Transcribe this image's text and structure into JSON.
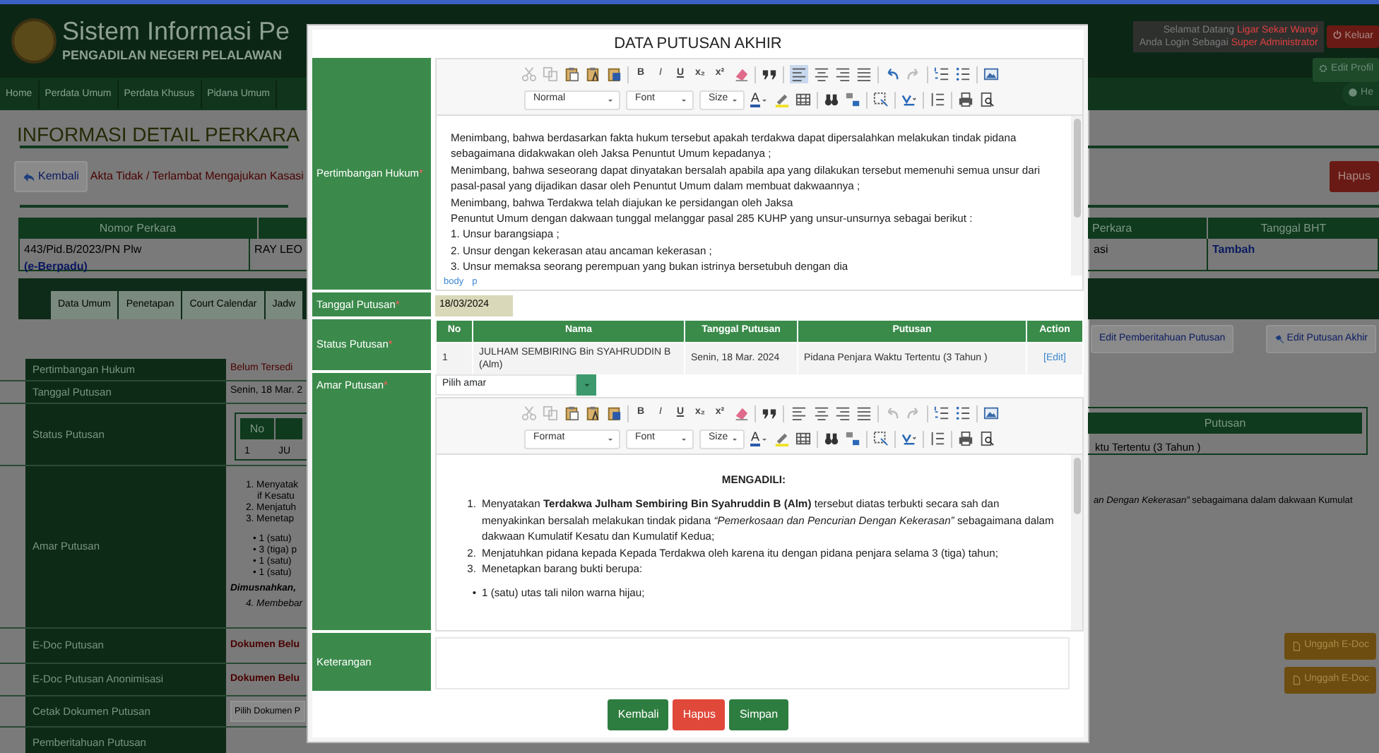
{
  "header": {
    "title": "Sistem Informasi Pe",
    "subtitle": "PENGADILAN NEGERI PELALAWAN",
    "welcome": {
      "greeting": "Selamat Datang",
      "user": "Ligar Sekar Wangi",
      "login_as": "Anda Login Sebagai",
      "role": "Super Administrator"
    },
    "logout_button": "Keluar",
    "profile_button": "Edit Profil"
  },
  "nav": {
    "items": [
      "Home",
      "Perdata Umum",
      "Perdata Khusus",
      "Pidana Umum"
    ],
    "help_button": "He"
  },
  "page": {
    "title": "INFORMASI DETAIL PERKARA",
    "back_button": "Kembali",
    "notice": "Akta Tidak / Terlambat Mengajukan Kasasi",
    "delete_button": "Hapus",
    "case_table": {
      "columns": [
        "Nomor Perkara",
        "Perkara",
        "Tanggal BHT"
      ],
      "cells": [
        "443/Pid.B/2023/PN Plw",
        "RAY LEO",
        "asi",
        "Tambah"
      ],
      "tag": "(e-Berpadu)"
    },
    "tabs": [
      "Data Umum",
      "Penetapan",
      "Court Calendar",
      "Jadw"
    ],
    "action_buttons": [
      "Edit Pemberitahuan Putusan",
      "Edit Putusan Akhir"
    ],
    "details": {
      "labels": [
        "Pertimbangan Hukum",
        "Tanggal Putusan",
        "Status Putusan",
        "Amar Putusan",
        "E-Doc Putusan",
        "E-Doc Putusan Anonimisasi",
        "Cetak Dokumen Putusan",
        "Pemberitahuan Putusan"
      ],
      "pertimbangan": "Belum Tersedi",
      "tanggal": "Senin, 18 Mar. 2",
      "status_table": {
        "columns": [
          "No",
          "Putusan"
        ],
        "cells": [
          "1",
          "JU",
          "ktu Tertentu (3 Tahun )"
        ]
      },
      "amar_lines": [
        {
          "kind": "numbered",
          "text": "1. Menyatak"
        },
        {
          "kind": "continued",
          "text": "if Kesatu"
        },
        {
          "kind": "numbered",
          "text": "2. Menjatuh"
        },
        {
          "kind": "numbered",
          "text": "3. Menetap"
        },
        {
          "kind": "bullet",
          "text": "• 1 (satu)"
        },
        {
          "kind": "bullet",
          "text": "• 3 (tiga) p"
        },
        {
          "kind": "bullet",
          "text": "• 1 (satu)"
        },
        {
          "kind": "bullet",
          "text": "• 1 (satu)"
        },
        {
          "kind": "note",
          "text": "Dimusnahkan,"
        },
        {
          "kind": "numbered",
          "text": "4. Membebar"
        }
      ],
      "amar_tail": "*an Dengan Kekerasan”* sebagaimana dalam dakwaan Kumulat",
      "edoc": [
        "Dokumen Belu",
        "Dokumen Belu"
      ],
      "upload_buttons": [
        "Unggah E-Doc",
        "Unggah E-Doc"
      ],
      "print_select": "Pilih Dokumen P"
    }
  },
  "modal": {
    "title": "DATA PUTUSAN AKHIR",
    "fields": [
      {
        "kind": "editor",
        "label": "Pertimbangan Hukum",
        "marker": "*",
        "toolbar": {
          "style": "Normal",
          "font": "Font",
          "size": "Size",
          "glyphs": [
            "B",
            "I",
            "U",
            "x₂",
            "x²"
          ],
          "color_glyph": "A",
          "align_left_active": true,
          "undo_enabled": true
        },
        "blocks": [
          {
            "kind": "p",
            "text": "Menimbang, bahwa berdasarkan fakta hukum tersebut apakah terdakwa dapat dipersalahkan melakukan tindak pidana sebagaimana didakwakan oleh Jaksa Penuntut Umum kepadanya ;"
          },
          {
            "kind": "p",
            "text": "Menimbang, bahwa seseorang dapat dinyatakan bersalah apabila apa yang dilakukan tersebut memenuhi semua unsur dari pasal-pasal yang dijadikan dasar oleh Penuntut Umum dalam membuat dakwaannya ;"
          },
          {
            "kind": "p",
            "text": "Menimbang, bahwa Terdakwa telah diajukan ke persidangan oleh Jaksa"
          },
          {
            "kind": "p",
            "text": "Penuntut Umum dengan dakwaan tunggal melanggar pasal 285 KUHP yang unsur-unsurnya sebagai berikut :"
          },
          {
            "kind": "p",
            "text": "1. Unsur barangsiapa ;"
          },
          {
            "kind": "p",
            "text": "2. Unsur dengan kekerasan atau ancaman kekerasan ;"
          },
          {
            "kind": "p",
            "text": "3. Unsur memaksa seorang perempuan yang bukan istrinya bersetubuh dengan dia"
          }
        ],
        "path": [
          "body",
          "p"
        ]
      },
      {
        "kind": "date",
        "label": "Tanggal Putusan",
        "marker": "*",
        "value": "18/03/2024"
      },
      {
        "kind": "table",
        "label": "Status Putusan",
        "marker": "*",
        "columns": [
          "No",
          "Nama",
          "Tanggal Putusan",
          "Putusan",
          "Action"
        ],
        "rows": [
          {
            "no": "1",
            "nama": "JULHAM SEMBIRING Bin SYAHRUDDIN B (Alm)",
            "tanggal": "Senin, 18 Mar. 2024",
            "putusan": "Pidana Penjara Waktu Tertentu (3 Tahun )",
            "action": "[Edit]"
          }
        ]
      },
      {
        "kind": "editor",
        "label": "Amar Putusan",
        "marker": "*",
        "select": "Pilih amar",
        "toolbar": {
          "style": "Format",
          "font": "Font",
          "size": "Size",
          "glyphs": [
            "B",
            "I",
            "U",
            "x₂",
            "x²"
          ],
          "color_glyph": "A",
          "align_left_active": false,
          "undo_enabled": false
        },
        "blocks": [
          {
            "kind": "heading",
            "text": "MENGADILI:"
          },
          {
            "kind": "numbered",
            "number": "1.",
            "text": "Menyatakan **Terdakwa Julham Sembiring Bin Syahruddin B (Alm)** tersebut diatas terbukti secara sah dan menyakinkan bersalah melakukan tindak pidana *“Pemerkosaan dan Pencurian Dengan Kekerasan”* sebagaimana dalam dakwaan Kumulatif Kesatu dan Kumulatif Kedua;"
          },
          {
            "kind": "numbered",
            "number": "2.",
            "text": "Menjatuhkan pidana kepada Kepada Terdakwa oleh karena itu dengan pidana penjara selama 3 (tiga) tahun;"
          },
          {
            "kind": "numbered",
            "number": "3.",
            "text": "Menetapkan barang bukti berupa:"
          },
          {
            "kind": "bullet",
            "bullet": "•",
            "text": "1 (satu) utas tali nilon warna hijau;"
          }
        ]
      },
      {
        "kind": "textarea",
        "label": "Keterangan"
      }
    ],
    "buttons": [
      {
        "label": "Kembali",
        "kind": "back"
      },
      {
        "label": "Hapus",
        "kind": "delete"
      },
      {
        "label": "Simpan",
        "kind": "save"
      }
    ]
  }
}
